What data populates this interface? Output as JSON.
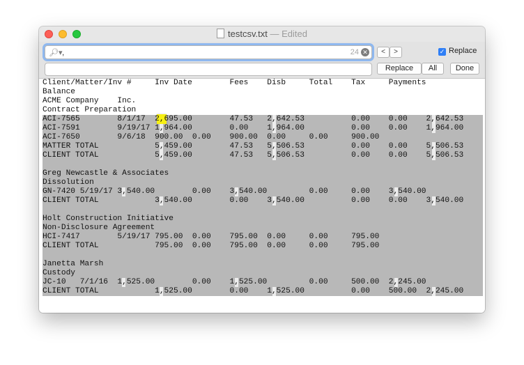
{
  "window": {
    "title": "testcsv.txt",
    "title_suffix": "— Edited"
  },
  "find_bar": {
    "search_value": ",",
    "match_count": "24",
    "prev_label": "<",
    "next_label": ">",
    "replace_checkbox_label": "Replace",
    "replace_checked": true,
    "replace_value": "",
    "replace_button": "Replace",
    "all_button": "All",
    "done_button": "Done"
  },
  "document": {
    "lines": [
      "Client/Matter/Inv #     Inv Date        Fees    Disb     Total    Tax     Payments",
      "Balance",
      "ACME Company    Inc.",
      "Contract Preparation",
      "ACI-7565        8/1/17  2,695.00        47.53   2,642.53          0.00    0.00    2,642.53",
      "ACI-7591        9/19/17 1,964.00        0.00    1,964.00          0.00    0.00    1,964.00",
      "ACI-7650        9/6/18  900.00  0.00    900.00  0.00     0.00     900.00",
      "MATTER TOTAL            5,459.00        47.53   5,506.53          0.00    0.00    5,506.53",
      "CLIENT TOTAL            5,459.00        47.53   5,506.53          0.00    0.00    5,506.53",
      "",
      "Greg Newcastle & Associates",
      "Dissolution",
      "GN-7420 5/19/17 3,540.00        0.00    3,540.00         0.00     0.00    3,540.00",
      "CLIENT TOTAL            3,540.00        0.00    3,540.00          0.00    0.00    3,540.00",
      "",
      "Holt Construction Initiative",
      "Non-Disclosure Agreement",
      "HCI-7417        5/19/17 795.00  0.00    795.00  0.00     0.00     795.00",
      "CLIENT TOTAL            795.00  0.00    795.00  0.00     0.00     795.00",
      "",
      "Janetta Marsh",
      "Custody",
      "JC-10   7/1/16  1,525.00        0.00    1,525.00         0.00     500.00  2,245.00",
      "CLIENT TOTAL            1,525.00        0.00    1,525.00          0.00    500.00  2,245.00"
    ]
  }
}
